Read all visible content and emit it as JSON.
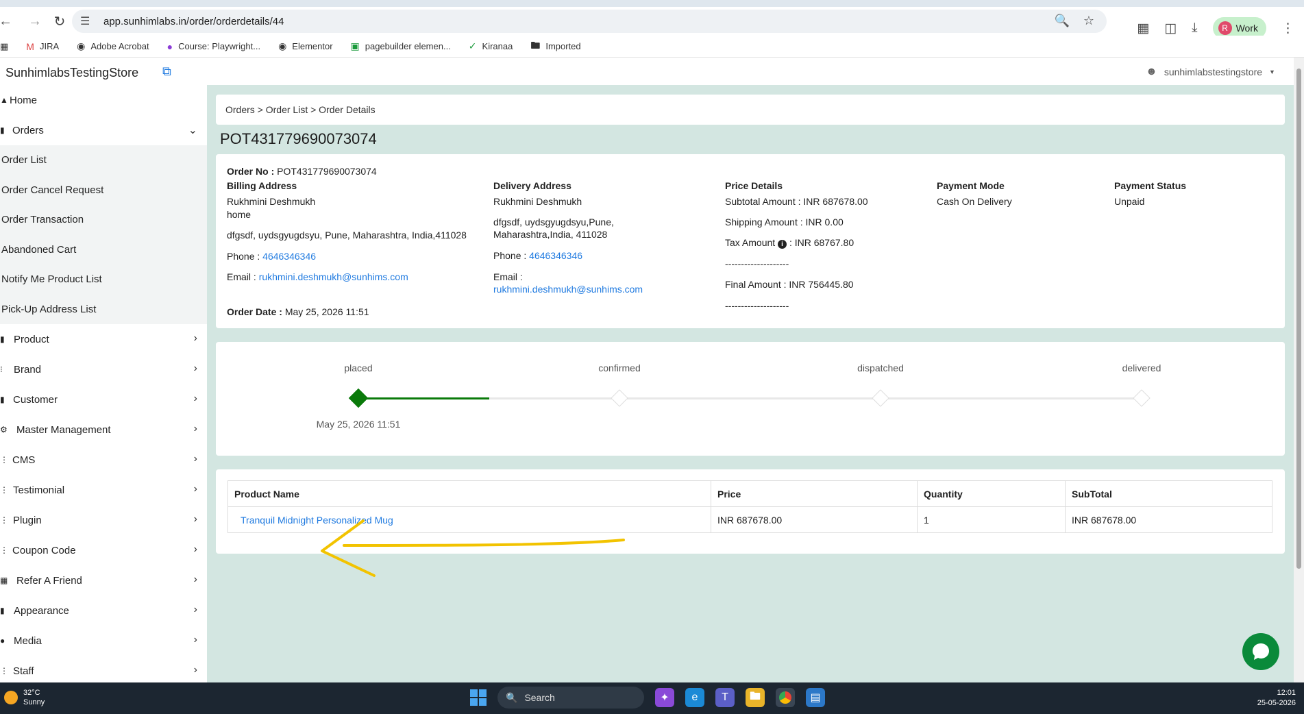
{
  "browser": {
    "url": "app.sunhimlabs.in/order/orderdetails/44",
    "profile_initial": "R",
    "profile_label": "Work",
    "bookmarks": [
      "JIRA",
      "Adobe Acrobat",
      "Course: Playwright...",
      "Elementor",
      "pagebuilder elemen...",
      "Kiranaa",
      "Imported"
    ]
  },
  "sidebar": {
    "brand": "SunhimlabsTestingStore",
    "home": "Home",
    "orders": "Orders",
    "order_sub": [
      "Order List",
      "Order Cancel Request",
      "Order Transaction",
      "Abandoned Cart",
      "Notify Me Product List",
      "Pick-Up Address List"
    ],
    "sections": [
      "Product",
      "Brand",
      "Customer",
      "Master Management",
      "CMS",
      "Testimonial",
      "Plugin",
      "Coupon Code",
      "Refer A Friend",
      "Appearance",
      "Media",
      "Staff"
    ]
  },
  "header": {
    "user": "sunhimlabstestingstore"
  },
  "breadcrumb": "Orders > Order List > Order Details",
  "order": {
    "title": "POT431779690073074",
    "order_no_label": "Order No :",
    "order_no": "POT431779690073074",
    "billing_heading": "Billing Address",
    "billing_name": "Rukhmini Deshmukh",
    "billing_type": "home",
    "billing_address": "dfgsdf, uydsgyugdsyu, Pune, Maharashtra, India,411028",
    "phone_label": "Phone :",
    "phone": "4646346346",
    "email_label": "Email :",
    "email": "rukhmini.deshmukh@sunhims.com",
    "order_date_label": "Order Date :",
    "order_date": "May 25, 2026 11:51",
    "delivery_heading": "Delivery Address",
    "delivery_name": "Rukhmini Deshmukh",
    "delivery_address_1": "dfgsdf, uydsgyugdsyu,Pune,",
    "delivery_address_2": "Maharashtra,India, 411028",
    "price_heading": "Price Details",
    "subtotal": "Subtotal Amount : INR 687678.00",
    "shipping": "Shipping Amount : INR 0.00",
    "tax_label": "Tax Amount",
    "tax_value": ": INR  68767.80",
    "separator": "--------------------",
    "final": "Final Amount : INR  756445.80",
    "payment_mode_heading": "Payment Mode",
    "payment_mode": "Cash On Delivery",
    "payment_status_heading": "Payment Status",
    "payment_status": "Unpaid"
  },
  "status": {
    "steps": [
      "placed",
      "confirmed",
      "dispatched",
      "delivered"
    ],
    "placed_date": "May 25, 2026 11:51",
    "accent": "#0a7a0a"
  },
  "products": {
    "headers": [
      "Product Name",
      "Price",
      "Quantity",
      "SubTotal"
    ],
    "rows": [
      {
        "name": "Tranquil Midnight Personalized Mug",
        "price": "INR 687678.00",
        "quantity": "1",
        "subtotal": "INR 687678.00"
      }
    ]
  },
  "taskbar": {
    "temp": "32°C",
    "condition": "Sunny",
    "search": "Search",
    "time": "12:01",
    "date": "25-05-2026"
  }
}
